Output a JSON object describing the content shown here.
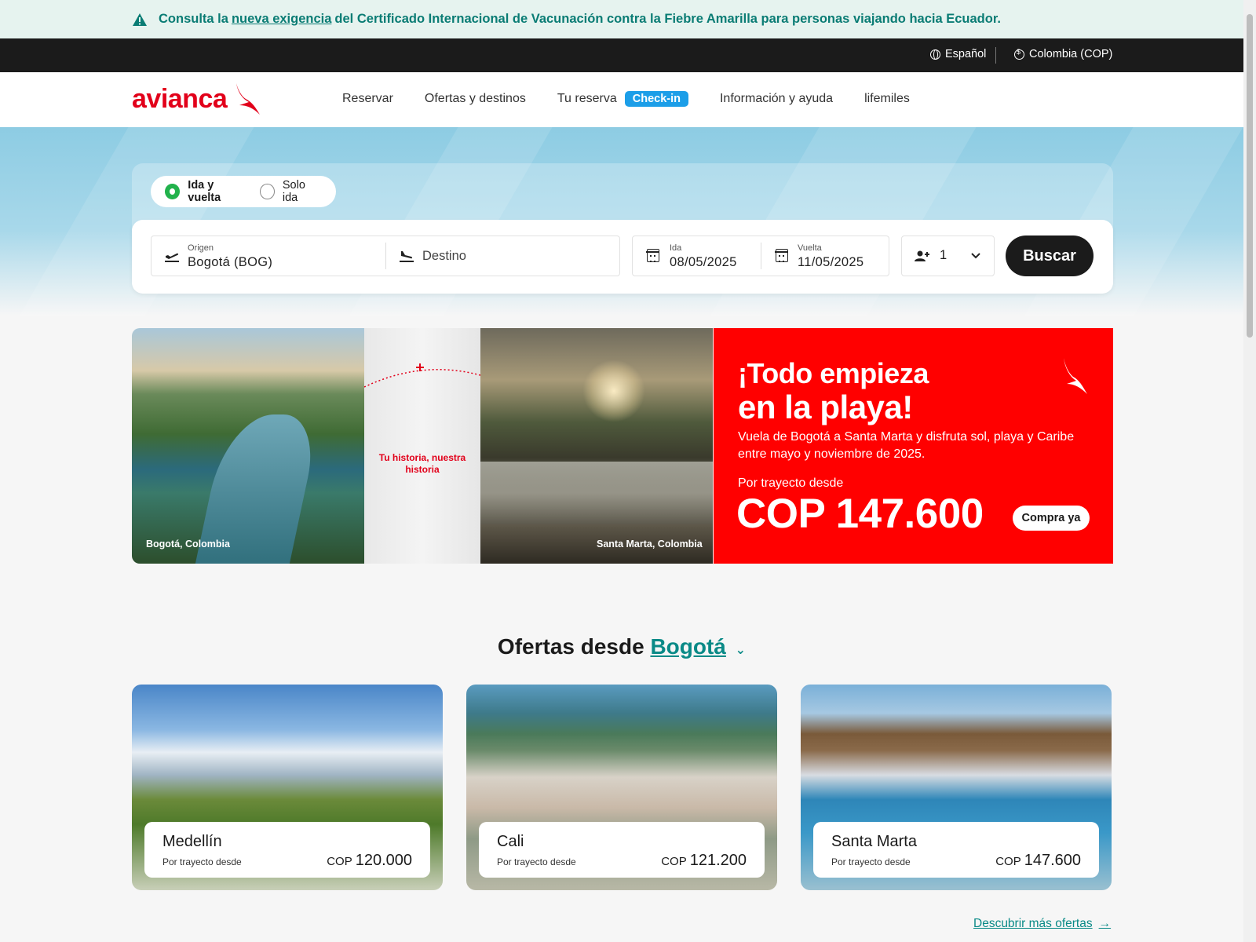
{
  "alert": {
    "pre": "Consulta la",
    "link": "nueva exigencia",
    "post": "del Certificado Internacional de Vacunación contra la Fiebre Amarilla para personas viajando hacia Ecuador."
  },
  "topbar": {
    "language": "Español",
    "currency": "Colombia (COP)"
  },
  "nav": {
    "logo": "avianca",
    "items": [
      "Reservar",
      "Ofertas y destinos",
      "Tu reserva",
      "Información y ayuda",
      "lifemiles"
    ],
    "checkin": "Check-in"
  },
  "search": {
    "trip_round": "Ida y vuelta",
    "trip_oneway": "Solo ida",
    "trip_selected": "Ida y vuelta",
    "origin_label": "Origen",
    "origin_value": "Bogotá  (BOG)",
    "destination_placeholder": "Destino",
    "depart_label": "Ida",
    "depart_value": "08/05/2025",
    "return_label": "Vuelta",
    "return_value": "11/05/2025",
    "passengers": "1",
    "button": "Buscar"
  },
  "banner": {
    "left_caption": "Bogotá, Colombia",
    "middle_text": "Tu historia, nuestra historia",
    "right_caption": "Santa Marta, Colombia",
    "headline_1": "¡Todo empieza",
    "headline_2": "en la playa!",
    "description": "Vuela de Bogotá a Santa Marta y disfruta sol, playa y Caribe entre mayo y noviembre de 2025.",
    "from_label": "Por trayecto desde",
    "price": "COP 147.600",
    "cta": "Compra ya"
  },
  "offers": {
    "title_prefix": "Ofertas desde",
    "city": "Bogotá",
    "cards": [
      {
        "city": "Medellín",
        "sub": "Por trayecto desde",
        "currency": "COP",
        "price": "120.000"
      },
      {
        "city": "Cali",
        "sub": "Por trayecto desde",
        "currency": "COP",
        "price": "121.200"
      },
      {
        "city": "Santa Marta",
        "sub": "Por trayecto desde",
        "currency": "COP",
        "price": "147.600"
      }
    ],
    "more": "Descubrir más ofertas"
  },
  "colors": {
    "brand_red": "#e2001a",
    "promo_red": "#ff0000",
    "teal": "#0a8a87",
    "checkin_blue": "#1c9ee8",
    "radio_green": "#22b24c"
  }
}
